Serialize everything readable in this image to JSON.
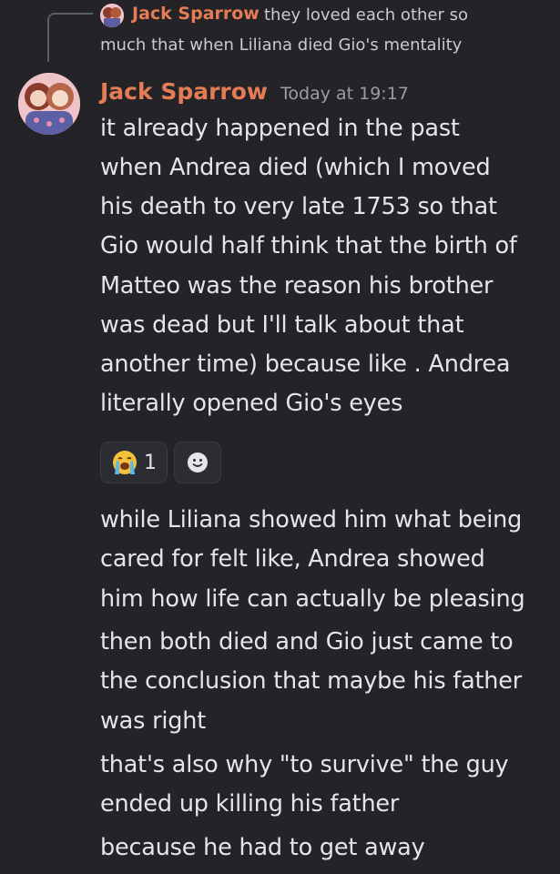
{
  "reply": {
    "author": "Jack Sparrow",
    "text_line1": "they loved each other so",
    "text_line2": "much that when Liliana died Gio's mentality"
  },
  "message1": {
    "author": "Jack Sparrow",
    "timestamp": "Today at 19:17",
    "lines": [
      "it already happened in the past",
      "when Andrea died (which I moved",
      "his death to very late 1753 so that",
      "Gio would half think that the birth of",
      "Matteo was the reason his brother",
      "was dead but I'll talk about that",
      "another time) because like . Andrea",
      "literally opened Gio's eyes"
    ],
    "reactions": [
      {
        "icon": "loudly-crying-face-emoji",
        "count": "1"
      },
      {
        "icon": "add-reaction-icon"
      }
    ]
  },
  "message2": {
    "lines": [
      "while Liliana showed him what being",
      "cared for felt like, Andrea showed",
      "him how life can actually be pleasing"
    ]
  },
  "message3": {
    "lines": [
      "then both died and Gio just came to",
      "the conclusion that maybe his father",
      "was right"
    ]
  },
  "message4": {
    "lines": [
      "that's also why \"to survive\" the guy",
      "ended up killing his father"
    ]
  },
  "message5": {
    "lines": [
      "because he had to get away"
    ]
  },
  "colors": {
    "background": "#232328",
    "author": "#e67c54",
    "text": "#e4e5e9",
    "muted": "#9b9da6"
  }
}
